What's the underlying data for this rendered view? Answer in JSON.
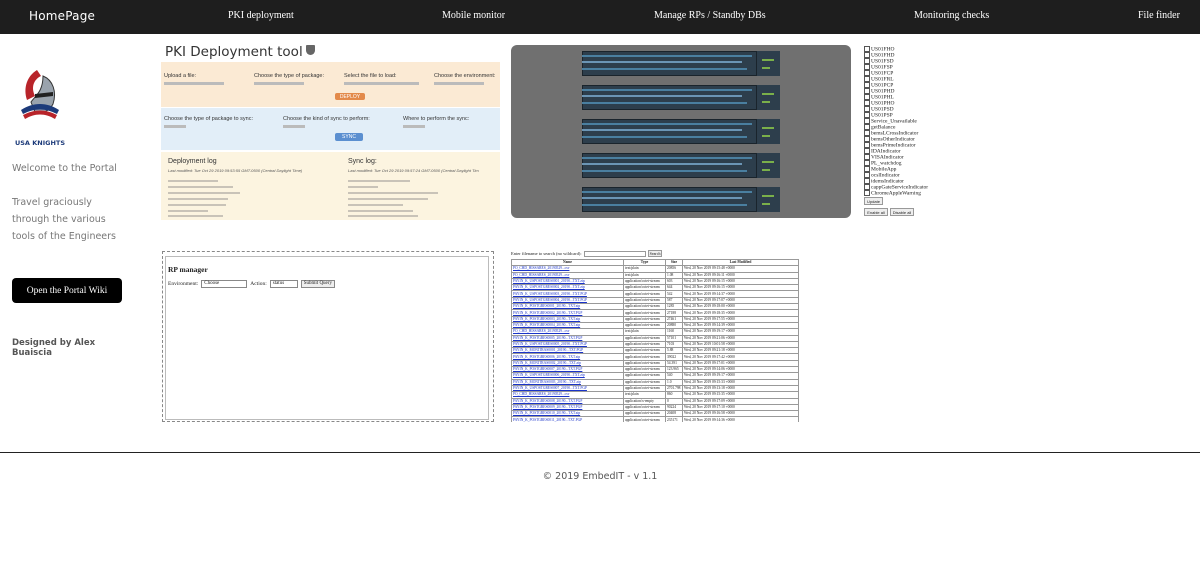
{
  "nav": {
    "brand": "HomePage",
    "items": [
      {
        "label": "PKI deployment"
      },
      {
        "label": "Mobile monitor"
      },
      {
        "label": "Manage RPs / Standby DBs"
      },
      {
        "label": "Monitoring checks"
      },
      {
        "label": "File finder"
      }
    ]
  },
  "sidebar": {
    "logo_text": "USA KNIGHTS",
    "welcome": "Welcome to the Portal",
    "tagline": [
      "Travel graciously",
      "through the various",
      "tools of the Engineers"
    ],
    "wiki_button": "Open the Portal Wiki",
    "credit": "Designed by Alex Buaiscia"
  },
  "pki": {
    "title": "PKI Deployment tool",
    "upload_label": "Upload a file:",
    "package_label": "Choose the type of package:",
    "select_label": "Select the file to load:",
    "env_label": "Choose the environment:",
    "deploy_button": "DEPLOY",
    "sync_package_label": "Choose the type of package to sync:",
    "sync_kind_label": "Choose the kind of sync to perform:",
    "sync_where_label": "Where to perform the sync:",
    "sync_button": "SYNC",
    "deploy_log_title": "Deployment log",
    "deploy_log_sub": "Last modified: Tue Oct 29 2019 09:53:55 GMT-0500 (Central Daylight Time)",
    "sync_log_title": "Sync log:",
    "sync_log_sub": "Last modified: Tue Oct 29 2019 09:57:24 GMT-0500 (Central Daylight Tim"
  },
  "checks": {
    "items": [
      "US01FHO",
      "US01FHD",
      "US01FSD",
      "US01FSP",
      "US01FCP",
      "US01FRL",
      "US01PCP",
      "US01PHD",
      "US01PHL",
      "US01PHO",
      "US01PSD",
      "US01PSP",
      "Service_Unavailable",
      "getBalance",
      "bemsLCrossIndicator",
      "bemsOtherIndicator",
      "bemsPrimeIndicator",
      "IDAIndicator",
      "VISAIndicator",
      "PL_watchdog",
      "MobileApp",
      "ocslIndicator",
      "idemsIndicator",
      "cappGateServiceIndicator",
      "ChromeAppleWarning"
    ],
    "update_button": "Update",
    "enable_all": "Enable all",
    "disable_all": "Disable all"
  },
  "rp": {
    "title": "RP manager",
    "env_label": "Environment:",
    "env_value": "Choose",
    "action_label": "Action:",
    "action_value": "status",
    "submit_button": "Submit Query"
  },
  "filefinder": {
    "search_label": "Enter filename to search (no wildcard):",
    "search_button": "Search",
    "columns": [
      "Name",
      "Type",
      "Size",
      "Last Modified"
    ],
    "rows": [
      [
        "PO_CHD_HISSARES_20190529...csv",
        "text/plain",
        "20856",
        "Wed, 20 Nov 2019 09:15:48 +0000"
      ],
      [
        "PO_CHD_HISSARES_20190529...csv",
        "text/plain",
        "1.08",
        "Wed, 20 Nov 2019 09:16:11 +0000"
      ],
      [
        "PAYIN_K_USPOSTGRES0001_20190...TXT.zip",
        "application/octet-stream",
        "603",
        "Wed, 20 Nov 2019 09:16:15 +0000"
      ],
      [
        "PAYIN_K_USPOSTGRES0002_20190...TXT.zip",
        "application/octet-stream",
        "644",
        "Wed, 20 Nov 2019 09:16:15 +0000"
      ],
      [
        "PAYIN_K_USPOSTGRES0003_20190...TXT.PGP",
        "application/octet-stream",
        "542",
        "Wed, 20 Nov 2019 09:14:37 +0000"
      ],
      [
        "PAYIN_K_USPOSTGRES0004_20190...TXT.PGP",
        "application/octet-stream",
        "587",
        "Wed, 20 Nov 2019 09:17:07 +0000"
      ],
      [
        "PAYIN_K_POSTGRES0001_20190...TXT.zip",
        "application/octet-stream",
        "1285",
        "Wed, 20 Nov 2019 09:18:00 +0000"
      ],
      [
        "PAYIN_K_POSTGRES0002_20190...TXT.PGP",
        "application/octet-stream",
        "27188",
        "Wed, 20 Nov 2019 09:18:35 +0000"
      ],
      [
        "PAYIN_K_POSTGRES0003_20190...TXT.zip",
        "application/octet-stream",
        "27461",
        "Wed, 20 Nov 2019 09:17:55 +0000"
      ],
      [
        "PAYIN_K_POSTGRES0004_20190...TXT.zip",
        "application/octet-stream",
        "20880",
        "Wed, 20 Nov 2019 09:14:39 +0000"
      ],
      [
        "PO_CHD_HISSARES_20190529...csv",
        "text/plain",
        "1160",
        "Wed, 20 Nov 2019 09:19:17 +0000"
      ],
      [
        "PAYIN_K_POSTGRES0005_20190...TXT.PGP",
        "application/octet-stream",
        "57101",
        "Wed, 20 Nov 2019 09:21:06 +0000"
      ],
      [
        "PAYIN_K_USPOSTGRES0005_20190...TXT.PGP",
        "application/octet-stream",
        "7103",
        "Wed, 20 Nov 2019 10:01:58 +0000"
      ],
      [
        "PAYIN_K_MONITRAS0001_20190...TXT.PGP",
        "application/octet-stream",
        "5.88",
        "Wed, 20 Nov 2019 09:21:18 +0000"
      ],
      [
        "PAYIN_K_POSTGRES0006_20190...TXT.zip",
        "application/octet-stream",
        "39022",
        "Wed, 20 Nov 2019 09:17:42 +0000"
      ],
      [
        "PAYIN_K_MONITRAS0002_20190...TXT.zip",
        "application/octet-stream",
        "54.391",
        "Wed, 20 Nov 2019 09:17:01 +0000"
      ],
      [
        "PAYIN_K_POSTGRES0007_20190...TXT.PGP",
        "application/octet-stream",
        "123.965",
        "Wed, 20 Nov 2019 09:14:06 +0000"
      ],
      [
        "PAYIN_K_USPOSTGRES0006_20190...TXT.zip",
        "application/octet-stream",
        "540",
        "Wed, 20 Nov 2019 09:19:17 +0000"
      ],
      [
        "PAYIN_K_MONITRAS0003_20190...TXT.zip",
        "application/octet-stream",
        "1.0",
        "Wed, 20 Nov 2019 09:15:33 +0000"
      ],
      [
        "PAYIN_K_USPOSTGRES0007_20190...TXT.PGP",
        "application/octet-stream",
        "2701.798",
        "Wed, 20 Nov 2019 09:13:18 +0000"
      ],
      [
        "PO_CHD_HISSARES_20190529...csv",
        "text/plain",
        "860",
        "Wed, 20 Nov 2019 09:15:35 +0000"
      ],
      [
        "PAYIN_K_POSTGRES0008_20190...TXT.PGP",
        "application/x-empty",
        "0",
        "Wed, 20 Nov 2019 09:17:09 +0000"
      ],
      [
        "PAYIN_K_POSTGRES0009_20190...TXT.PGP",
        "application/octet-stream",
        "90224",
        "Wed, 20 Nov 2019 09:17:10 +0000"
      ],
      [
        "PAYIN_K_POSTGRES0010_20190...TXT.zip",
        "application/octet-stream",
        "20408",
        "Wed, 20 Nov 2019 09:16:58 +0000"
      ],
      [
        "PAYIN_K_POSTGRES0011_20190...TXT.PGP",
        "application/octet-stream",
        "235171",
        "Wed, 20 Nov 2019 09:14:36 +0000"
      ]
    ]
  },
  "footer": {
    "copyright": "© 2019 EmbedIT - v 1.1"
  }
}
